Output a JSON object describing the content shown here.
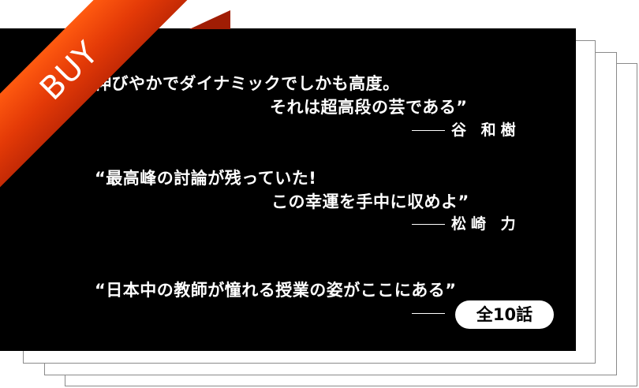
{
  "ribbon": {
    "label": "BUY",
    "color": "#ee4a0a"
  },
  "quotes": [
    {
      "line1": "伸びやかでダイナミックでしかも高度。",
      "line2": "それは超高段の芸である”",
      "author": "谷 和樹"
    },
    {
      "line1": "“最高峰の討論が残っていた!",
      "line2": "この幸運を手中に収めよ”",
      "author": "松崎 力"
    },
    {
      "line1": "“日本中の教師が憧れる授業の姿がここにある”",
      "author": "・・"
    }
  ],
  "badge": {
    "label": "全10話"
  }
}
